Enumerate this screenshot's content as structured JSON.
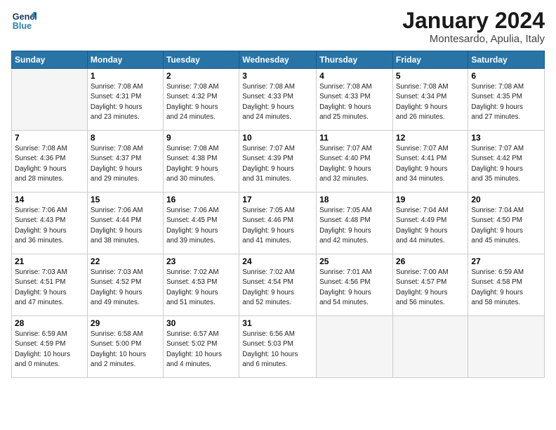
{
  "logo": {
    "line1": "General",
    "line2": "Blue"
  },
  "title": "January 2024",
  "subtitle": "Montesardo, Apulia, Italy",
  "days_header": [
    "Sunday",
    "Monday",
    "Tuesday",
    "Wednesday",
    "Thursday",
    "Friday",
    "Saturday"
  ],
  "weeks": [
    [
      {
        "day": "",
        "info": ""
      },
      {
        "day": "1",
        "info": "Sunrise: 7:08 AM\nSunset: 4:31 PM\nDaylight: 9 hours\nand 23 minutes."
      },
      {
        "day": "2",
        "info": "Sunrise: 7:08 AM\nSunset: 4:32 PM\nDaylight: 9 hours\nand 24 minutes."
      },
      {
        "day": "3",
        "info": "Sunrise: 7:08 AM\nSunset: 4:33 PM\nDaylight: 9 hours\nand 24 minutes."
      },
      {
        "day": "4",
        "info": "Sunrise: 7:08 AM\nSunset: 4:33 PM\nDaylight: 9 hours\nand 25 minutes."
      },
      {
        "day": "5",
        "info": "Sunrise: 7:08 AM\nSunset: 4:34 PM\nDaylight: 9 hours\nand 26 minutes."
      },
      {
        "day": "6",
        "info": "Sunrise: 7:08 AM\nSunset: 4:35 PM\nDaylight: 9 hours\nand 27 minutes."
      }
    ],
    [
      {
        "day": "7",
        "info": "Sunrise: 7:08 AM\nSunset: 4:36 PM\nDaylight: 9 hours\nand 28 minutes."
      },
      {
        "day": "8",
        "info": "Sunrise: 7:08 AM\nSunset: 4:37 PM\nDaylight: 9 hours\nand 29 minutes."
      },
      {
        "day": "9",
        "info": "Sunrise: 7:08 AM\nSunset: 4:38 PM\nDaylight: 9 hours\nand 30 minutes."
      },
      {
        "day": "10",
        "info": "Sunrise: 7:07 AM\nSunset: 4:39 PM\nDaylight: 9 hours\nand 31 minutes."
      },
      {
        "day": "11",
        "info": "Sunrise: 7:07 AM\nSunset: 4:40 PM\nDaylight: 9 hours\nand 32 minutes."
      },
      {
        "day": "12",
        "info": "Sunrise: 7:07 AM\nSunset: 4:41 PM\nDaylight: 9 hours\nand 34 minutes."
      },
      {
        "day": "13",
        "info": "Sunrise: 7:07 AM\nSunset: 4:42 PM\nDaylight: 9 hours\nand 35 minutes."
      }
    ],
    [
      {
        "day": "14",
        "info": "Sunrise: 7:06 AM\nSunset: 4:43 PM\nDaylight: 9 hours\nand 36 minutes."
      },
      {
        "day": "15",
        "info": "Sunrise: 7:06 AM\nSunset: 4:44 PM\nDaylight: 9 hours\nand 38 minutes."
      },
      {
        "day": "16",
        "info": "Sunrise: 7:06 AM\nSunset: 4:45 PM\nDaylight: 9 hours\nand 39 minutes."
      },
      {
        "day": "17",
        "info": "Sunrise: 7:05 AM\nSunset: 4:46 PM\nDaylight: 9 hours\nand 41 minutes."
      },
      {
        "day": "18",
        "info": "Sunrise: 7:05 AM\nSunset: 4:48 PM\nDaylight: 9 hours\nand 42 minutes."
      },
      {
        "day": "19",
        "info": "Sunrise: 7:04 AM\nSunset: 4:49 PM\nDaylight: 9 hours\nand 44 minutes."
      },
      {
        "day": "20",
        "info": "Sunrise: 7:04 AM\nSunset: 4:50 PM\nDaylight: 9 hours\nand 45 minutes."
      }
    ],
    [
      {
        "day": "21",
        "info": "Sunrise: 7:03 AM\nSunset: 4:51 PM\nDaylight: 9 hours\nand 47 minutes."
      },
      {
        "day": "22",
        "info": "Sunrise: 7:03 AM\nSunset: 4:52 PM\nDaylight: 9 hours\nand 49 minutes."
      },
      {
        "day": "23",
        "info": "Sunrise: 7:02 AM\nSunset: 4:53 PM\nDaylight: 9 hours\nand 51 minutes."
      },
      {
        "day": "24",
        "info": "Sunrise: 7:02 AM\nSunset: 4:54 PM\nDaylight: 9 hours\nand 52 minutes."
      },
      {
        "day": "25",
        "info": "Sunrise: 7:01 AM\nSunset: 4:56 PM\nDaylight: 9 hours\nand 54 minutes."
      },
      {
        "day": "26",
        "info": "Sunrise: 7:00 AM\nSunset: 4:57 PM\nDaylight: 9 hours\nand 56 minutes."
      },
      {
        "day": "27",
        "info": "Sunrise: 6:59 AM\nSunset: 4:58 PM\nDaylight: 9 hours\nand 58 minutes."
      }
    ],
    [
      {
        "day": "28",
        "info": "Sunrise: 6:59 AM\nSunset: 4:59 PM\nDaylight: 10 hours\nand 0 minutes."
      },
      {
        "day": "29",
        "info": "Sunrise: 6:58 AM\nSunset: 5:00 PM\nDaylight: 10 hours\nand 2 minutes."
      },
      {
        "day": "30",
        "info": "Sunrise: 6:57 AM\nSunset: 5:02 PM\nDaylight: 10 hours\nand 4 minutes."
      },
      {
        "day": "31",
        "info": "Sunrise: 6:56 AM\nSunset: 5:03 PM\nDaylight: 10 hours\nand 6 minutes."
      },
      {
        "day": "",
        "info": ""
      },
      {
        "day": "",
        "info": ""
      },
      {
        "day": "",
        "info": ""
      }
    ]
  ]
}
